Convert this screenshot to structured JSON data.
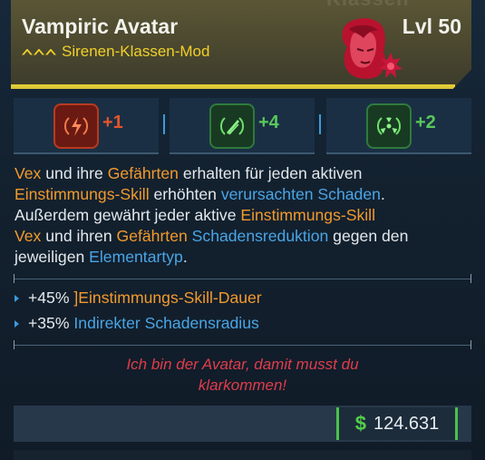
{
  "header": {
    "ghost_text": "Klassen",
    "title": "Vampiric Avatar",
    "level": "Lvl 50",
    "subtitle": "Sirenen-Klassen-Mod"
  },
  "skills": [
    {
      "icon": "red-lightning-skill-icon",
      "value": "+1",
      "color": "#e2552e"
    },
    {
      "icon": "green-slash-skill-icon",
      "value": "+4",
      "color": "#58c85a"
    },
    {
      "icon": "green-radiation-skill-icon",
      "value": "+2",
      "color": "#58c85a"
    }
  ],
  "description": {
    "l1_a": "Vex",
    "l1_b": " und ihre ",
    "l1_c": "Gefährten",
    "l1_d": " erhalten für jeden aktiven",
    "l2_a": "Einstimmungs-Skill",
    "l2_b": " erhöhten ",
    "l2_c": "verursachten Schaden",
    "l2_d": ".",
    "l3_a": "Außerdem gewährt jeder aktive ",
    "l3_b": "Einstimmungs-Skill",
    "l4_a": "Vex",
    "l4_b": " und ihren ",
    "l4_c": "Gefährten",
    "l4_d": " ",
    "l4_e": "Schadensreduktion",
    "l4_f": " gegen den",
    "l5_a": "jeweiligen ",
    "l5_b": "Elementartyp",
    "l5_c": "."
  },
  "stats": [
    {
      "value": "+45%",
      "label": "]Einstimmungs-Skill-Dauer"
    },
    {
      "value": "+35%",
      "label": "Indirekter Schadensradius"
    }
  ],
  "flavor": {
    "line1": "Ich bin der Avatar, damit musst du",
    "line2": "klarkommen!"
  },
  "price": {
    "symbol": "$",
    "amount": "124.631"
  },
  "colors": {
    "accent_yellow": "#f0d02a",
    "keyword_orange": "#f29a2c",
    "keyword_blue": "#4aa5e6",
    "flavor_red": "#e03c4c",
    "money_green": "#52d04a"
  }
}
